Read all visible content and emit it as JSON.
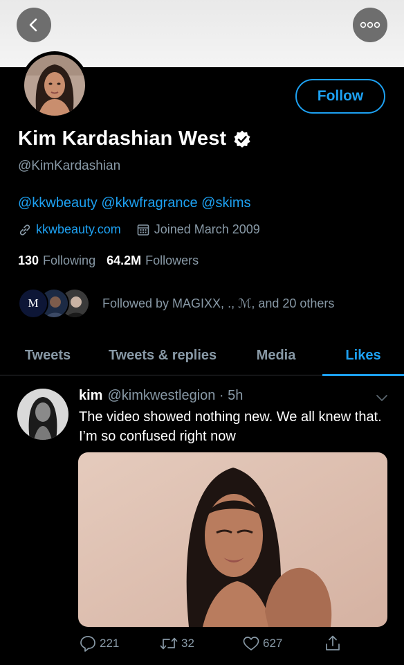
{
  "profile": {
    "follow_label": "Follow",
    "name": "Kim Kardashian West",
    "handle": "@KimKardashian",
    "bio_links": "@kkwbeauty @kkwfragrance @skims",
    "website": "kkwbeauty.com",
    "joined": "Joined March 2009",
    "following_count": "130",
    "following_label": "Following",
    "followers_count": "64.2M",
    "followers_label": "Followers",
    "followed_by": "Followed by MAGIXX, ., ℳ, and 20 others",
    "mini_avatar_letter": "M"
  },
  "tabs": [
    {
      "label": "Tweets"
    },
    {
      "label": "Tweets & replies"
    },
    {
      "label": "Media"
    },
    {
      "label": "Likes"
    }
  ],
  "tweet": {
    "name": "kim",
    "handle_time": "@kimkwestlegion · 5h",
    "text": "The video showed nothing new. We all knew that. I’m so confused right now",
    "replies": "221",
    "retweets": "32",
    "likes": "627"
  },
  "colors": {
    "accent": "#1da1f2",
    "muted": "#8899a6",
    "background": "#000000"
  },
  "icons": [
    "back-arrow-icon",
    "more-options-icon",
    "verified-badge-icon",
    "link-icon",
    "calendar-icon",
    "chevron-down-icon",
    "reply-icon",
    "retweet-icon",
    "like-icon",
    "share-icon"
  ]
}
